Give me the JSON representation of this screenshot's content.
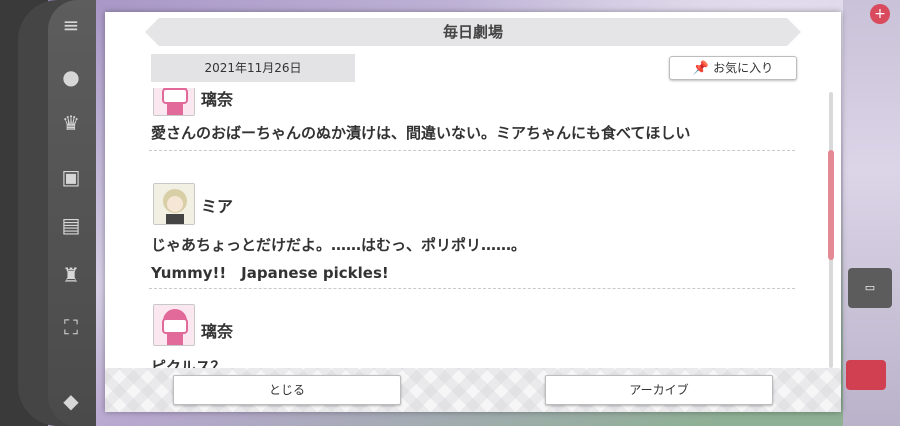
{
  "dialog": {
    "title": "毎日劇場",
    "date": "2021年11月26日",
    "favorite_label": "お気に入り",
    "favorite_icon": "pin-icon"
  },
  "entries": [
    {
      "speaker": "璃奈",
      "lines": [
        "愛さんのおばーちゃんのぬか漬けは、間違いない。ミアちゃんにも食べてほしい"
      ]
    },
    {
      "speaker": "ミア",
      "lines": [
        "じゃあちょっとだけだよ。……はむっ、ポリポリ……。",
        "Yummy!!　Japanese pickles!"
      ]
    },
    {
      "speaker": "璃奈",
      "lines": [
        "ピクルス？"
      ]
    }
  ],
  "footer": {
    "close_label": "とじる",
    "archive_label": "アーカイブ"
  },
  "colors": {
    "scroll_thumb": "#e48a95",
    "title_bar": "#e5e5e7",
    "date_box": "#e3e3e6"
  }
}
